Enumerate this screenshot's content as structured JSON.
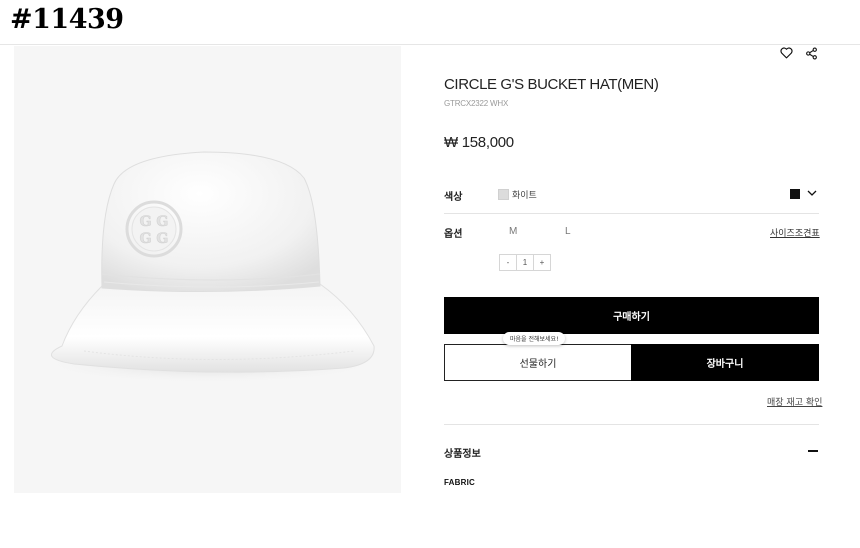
{
  "watermark": "#11439",
  "product": {
    "title": "CIRCLE G'S BUCKET HAT(MEN)",
    "sku": "GTRCX2322 WHX",
    "price": "₩ 158,000",
    "image_alt": "white bucket hat with embossed circle G logo"
  },
  "icons": {
    "wishlist": "heart-icon",
    "share": "share-icon",
    "dropdown": "chevron-down-icon",
    "collapse": "minus-icon"
  },
  "color": {
    "label": "색상",
    "selected": "화이트",
    "swatch_hex": "#dcdcdc",
    "chip_hex": "#111111"
  },
  "option": {
    "label": "옵션",
    "sizes": [
      "M",
      "L"
    ],
    "size_guide": "사이즈조견표"
  },
  "quantity": {
    "minus": "-",
    "value": "1",
    "plus": "+"
  },
  "actions": {
    "buy": "구매하기",
    "gift": "선물하기",
    "cart": "장바구니",
    "gift_tooltip": "마음을 전해보세요!",
    "store_stock": "매장 재고 확인"
  },
  "info": {
    "heading": "상품정보",
    "fabric_label": "FABRIC"
  }
}
